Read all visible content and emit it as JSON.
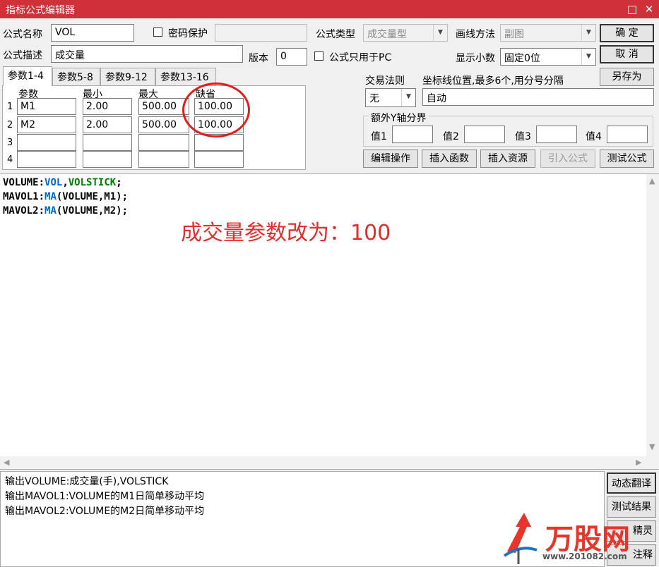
{
  "window": {
    "title": "指标公式编辑器",
    "min_icon": "minimize-icon",
    "close_icon": "close-icon"
  },
  "form": {
    "name_label": "公式名称",
    "name_value": "VOL",
    "password_label": "密码保护",
    "type_label": "公式类型",
    "type_value": "成交量型",
    "draw_label": "画线方法",
    "draw_value": "副图",
    "desc_label": "公式描述",
    "desc_value": "成交量",
    "version_label": "版本",
    "version_value": "0",
    "pc_only_label": "公式只用于PC",
    "decimal_label": "显示小数",
    "decimal_value": "固定0位",
    "trade_rule_label": "交易法则",
    "trade_rule_value": "无",
    "coord_label": "坐标线位置,最多6个,用分号分隔",
    "coord_value": "自动",
    "extra_y_label": "额外Y轴分界",
    "val1_label": "值1",
    "val2_label": "值2",
    "val3_label": "值3",
    "val4_label": "值4"
  },
  "buttons": {
    "ok": "确  定",
    "cancel": "取  消",
    "save_as": "另存为",
    "edit_ops": "编辑操作",
    "insert_func": "插入函数",
    "insert_res": "插入资源",
    "import_formula": "引入公式",
    "test_formula": "测试公式",
    "dynamic_translate": "动态翻译",
    "test_result": "测试结果",
    "wizard": "精灵",
    "comment": "注释"
  },
  "tabs": [
    "参数1-4",
    "参数5-8",
    "参数9-12",
    "参数13-16"
  ],
  "params": {
    "headers": [
      "参数",
      "最小",
      "最大",
      "缺省"
    ],
    "rows": [
      {
        "num": "1",
        "name": "M1",
        "min": "2.00",
        "max": "500.00",
        "default": "100.00"
      },
      {
        "num": "2",
        "name": "M2",
        "min": "2.00",
        "max": "500.00",
        "default": "100.00"
      },
      {
        "num": "3",
        "name": "",
        "min": "",
        "max": "",
        "default": ""
      },
      {
        "num": "4",
        "name": "",
        "min": "",
        "max": "",
        "default": ""
      }
    ]
  },
  "code": {
    "line1_a": "VOLUME:",
    "line1_b": "VOL",
    "line1_c": ",",
    "line1_d": "VOLSTICK",
    "line1_e": ";",
    "line2_a": "MAVOL1:",
    "line2_b": "MA",
    "line2_c": "(VOLUME,M1);",
    "line3_a": "MAVOL2:",
    "line3_b": "MA",
    "line3_c": "(VOLUME,M2);"
  },
  "annotation": "成交量参数改为：100",
  "output": [
    "输出VOLUME:成交量(手),VOLSTICK",
    "输出MAVOL1:VOLUME的M1日简单移动平均",
    "输出MAVOL2:VOLUME的M2日简单移动平均"
  ],
  "watermark": {
    "brand": "万股网",
    "url": "www.201082.com"
  },
  "colors": {
    "titlebar": "#d03038",
    "annotation": "#e52b2b",
    "circle": "#e21d1d",
    "code_blue": "#0066cc",
    "code_green": "#007d00"
  }
}
